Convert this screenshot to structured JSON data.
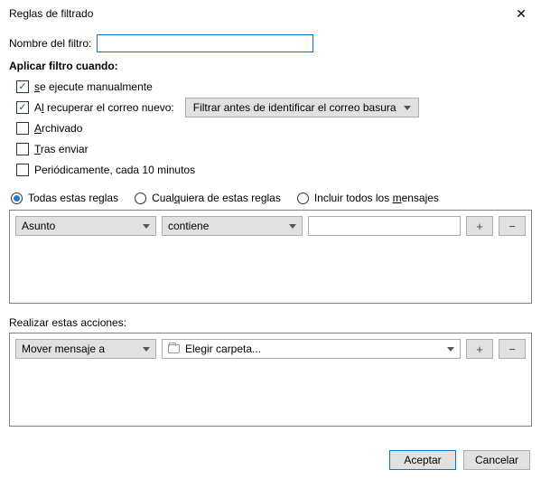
{
  "title": "Reglas de filtrado",
  "name_label": "Nombre del filtro:",
  "name_value": "",
  "apply_header": "Aplicar filtro cuando:",
  "checks": {
    "manual": {
      "label": "se ejecute manualmente",
      "underline": "s",
      "rest": "e ejecute manualmente",
      "checked": true
    },
    "onget": {
      "label_pre": "A",
      "label_u": "l",
      "label_post": " recuperar el correo nuevo:",
      "checked": true
    },
    "timing_value": "Filtrar antes de identificar el correo basura",
    "archived": {
      "label_u": "A",
      "label_post": "rchivado",
      "checked": false
    },
    "after_send": {
      "label_u": "T",
      "label_post": "ras enviar",
      "checked": false
    },
    "periodic": {
      "label": "Periódicamente, cada 10 minutos",
      "checked": false
    }
  },
  "match": {
    "all": "Todas estas reglas",
    "any_pre": "Cual",
    "any_u": "q",
    "any_post": "uiera de estas reglas",
    "every_pre": "Incluir todos los ",
    "every_u": "m",
    "every_post": "ensajes",
    "selected": "all"
  },
  "condition": {
    "field": "Asunto",
    "op": "contiene",
    "value": ""
  },
  "actions_header": "Realizar estas acciones:",
  "action": {
    "type": "Mover mensaje a",
    "folder": "Elegir carpeta..."
  },
  "buttons": {
    "plus": "+",
    "minus": "−",
    "ok": "Aceptar",
    "cancel": "Cancelar"
  }
}
